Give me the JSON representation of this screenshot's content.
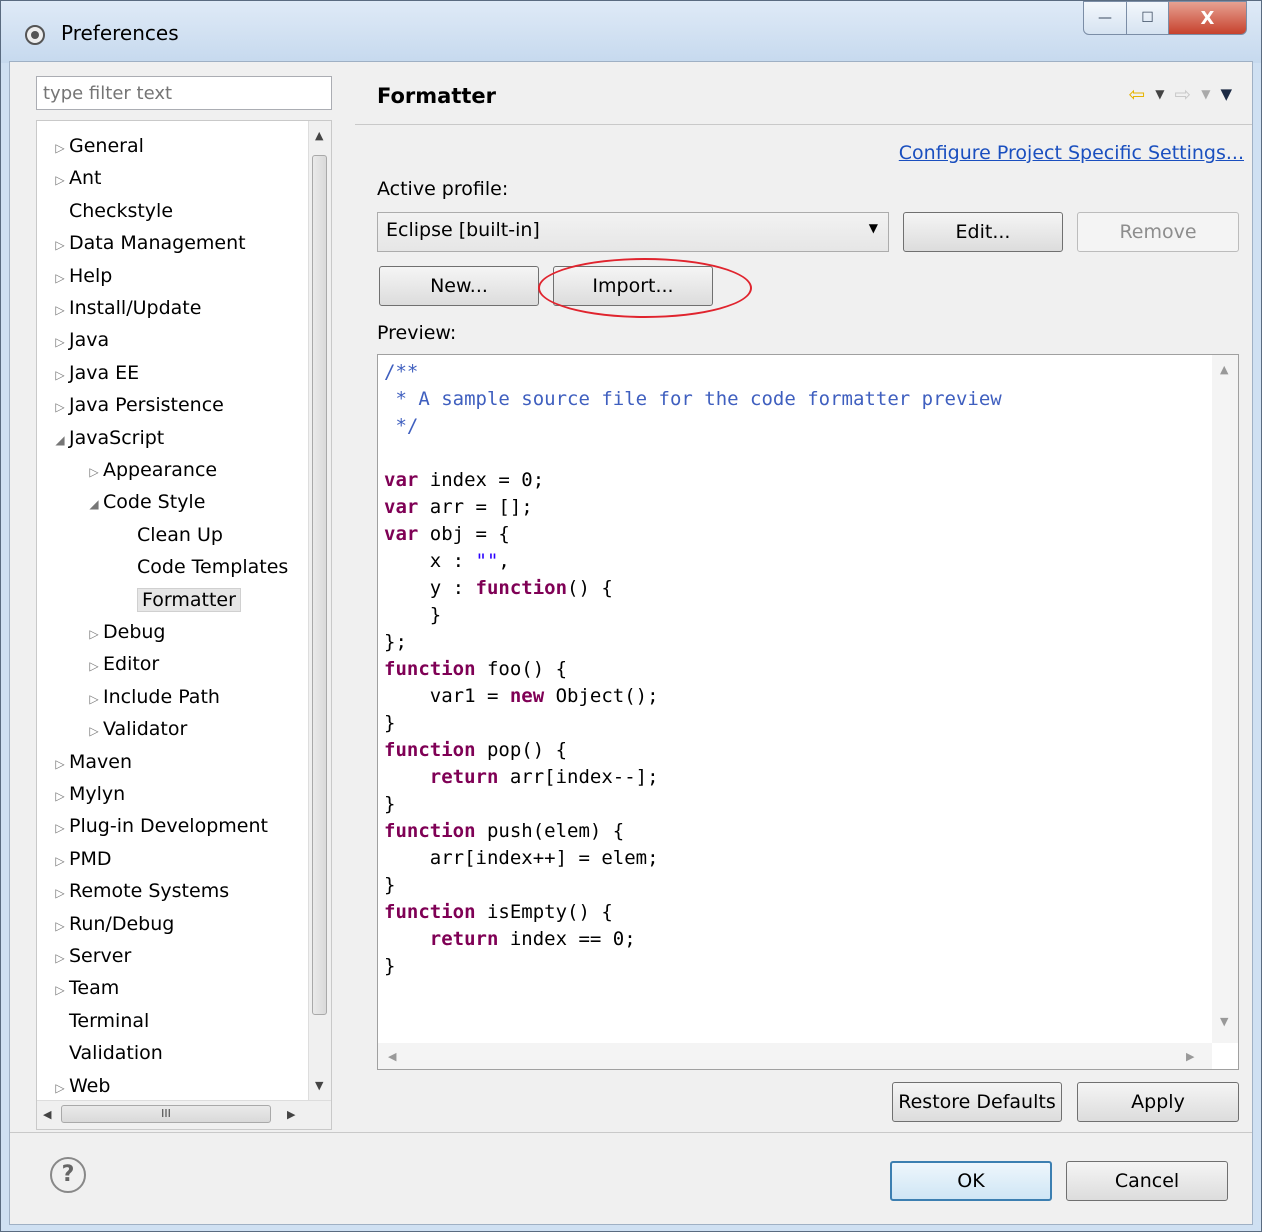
{
  "window": {
    "title": "Preferences",
    "minimize": "—",
    "maximize": "☐",
    "close": "X"
  },
  "sidebar": {
    "filter_placeholder": "type filter text",
    "items": [
      {
        "label": "General",
        "arrow": "▷"
      },
      {
        "label": "Ant",
        "arrow": "▷"
      },
      {
        "label": "Checkstyle",
        "arrow": ""
      },
      {
        "label": "Data Management",
        "arrow": "▷"
      },
      {
        "label": "Help",
        "arrow": "▷"
      },
      {
        "label": "Install/Update",
        "arrow": "▷"
      },
      {
        "label": "Java",
        "arrow": "▷"
      },
      {
        "label": "Java EE",
        "arrow": "▷"
      },
      {
        "label": "Java Persistence",
        "arrow": "▷"
      },
      {
        "label": "JavaScript",
        "arrow": "◢"
      },
      {
        "label": "Appearance",
        "arrow": "▷"
      },
      {
        "label": "Code Style",
        "arrow": "◢"
      },
      {
        "label": "Clean Up",
        "arrow": ""
      },
      {
        "label": "Code Templates",
        "arrow": ""
      },
      {
        "label": "Formatter",
        "arrow": "",
        "selected": true
      },
      {
        "label": "Debug",
        "arrow": "▷"
      },
      {
        "label": "Editor",
        "arrow": "▷"
      },
      {
        "label": "Include Path",
        "arrow": "▷"
      },
      {
        "label": "Validator",
        "arrow": "▷"
      },
      {
        "label": "Maven",
        "arrow": "▷"
      },
      {
        "label": "Mylyn",
        "arrow": "▷"
      },
      {
        "label": "Plug-in Development",
        "arrow": "▷"
      },
      {
        "label": "PMD",
        "arrow": "▷"
      },
      {
        "label": "Remote Systems",
        "arrow": "▷"
      },
      {
        "label": "Run/Debug",
        "arrow": "▷"
      },
      {
        "label": "Server",
        "arrow": "▷"
      },
      {
        "label": "Team",
        "arrow": "▷"
      },
      {
        "label": "Terminal",
        "arrow": ""
      },
      {
        "label": "Validation",
        "arrow": ""
      },
      {
        "label": "Web",
        "arrow": "▷"
      }
    ]
  },
  "main": {
    "title": "Formatter",
    "configure_link": "Configure Project Specific Settings...",
    "active_profile_label": "Active profile:",
    "profile_value": "Eclipse [built-in]",
    "edit_button": "Edit...",
    "remove_button": "Remove",
    "new_button": "New...",
    "import_button": "Import...",
    "preview_label": "Preview:",
    "restore_defaults_button": "Restore Defaults",
    "apply_button": "Apply"
  },
  "footer": {
    "ok_button": "OK",
    "cancel_button": "Cancel",
    "help_symbol": "?"
  },
  "colors": {
    "highlight_ellipse": "#e0242e",
    "link": "#1a4fbf",
    "keyword": "#7f0055",
    "comment": "#3f5fbf",
    "string": "#2a00ff"
  }
}
